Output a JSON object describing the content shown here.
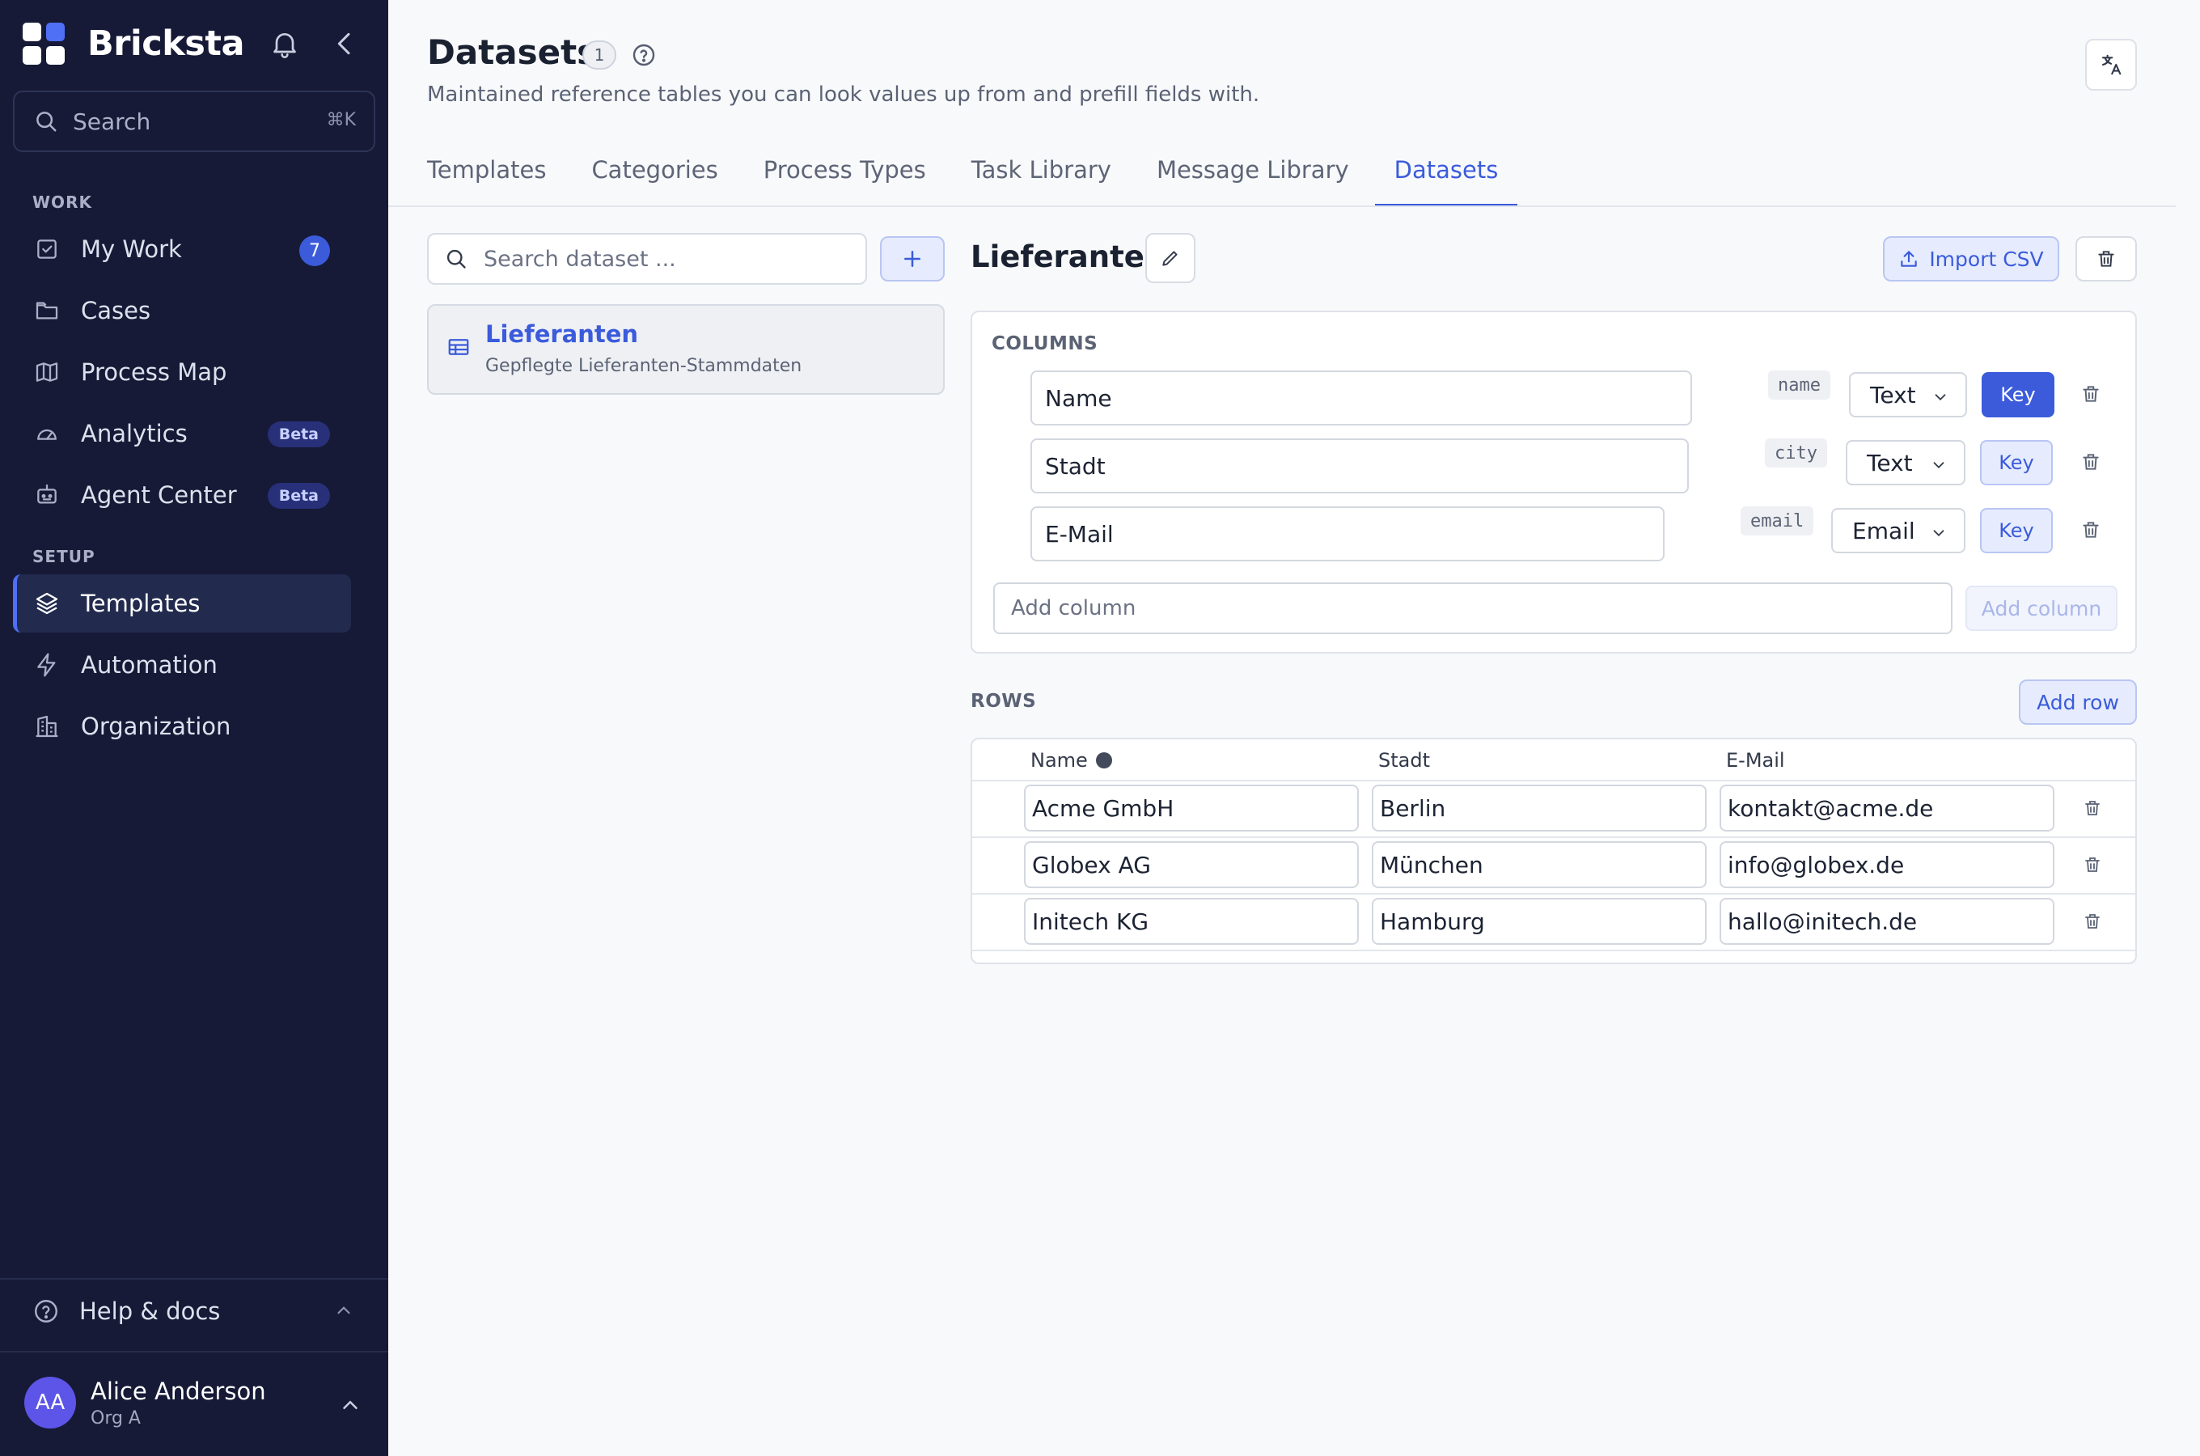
{
  "app": {
    "name": "Bricksta"
  },
  "sidebar": {
    "search": {
      "label": "Search",
      "shortcut": "⌘K"
    },
    "sections": {
      "work": "WORK",
      "setup": "SETUP"
    },
    "work_items": [
      {
        "label": "My Work",
        "icon": "checkbox-icon",
        "count": "7"
      },
      {
        "label": "Cases",
        "icon": "folder-icon"
      },
      {
        "label": "Process Map",
        "icon": "map-icon"
      },
      {
        "label": "Analytics",
        "icon": "gauge-icon",
        "badge": "Beta"
      },
      {
        "label": "Agent Center",
        "icon": "robot-icon",
        "badge": "Beta"
      }
    ],
    "setup_items": [
      {
        "label": "Templates",
        "icon": "layers-icon",
        "active": true
      },
      {
        "label": "Automation",
        "icon": "bolt-icon"
      },
      {
        "label": "Organization",
        "icon": "building-icon"
      }
    ],
    "help": "Help & docs",
    "user": {
      "initials": "AA",
      "name": "Alice Anderson",
      "org": "Org A"
    }
  },
  "header": {
    "title": "Datasets",
    "count": "1",
    "subtitle": "Maintained reference tables you can look values up from and prefill fields with."
  },
  "tabs": [
    {
      "label": "Templates"
    },
    {
      "label": "Categories"
    },
    {
      "label": "Process Types"
    },
    {
      "label": "Task Library"
    },
    {
      "label": "Message Library"
    },
    {
      "label": "Datasets",
      "active": true
    }
  ],
  "datasets": {
    "search_placeholder": "Search dataset ...",
    "items": [
      {
        "name": "Lieferanten",
        "description": "Gepflegte Lieferanten-Stammdaten"
      }
    ]
  },
  "detail": {
    "title": "Lieferanten",
    "import_label": "Import CSV",
    "columns_label": "COLUMNS",
    "columns": [
      {
        "label": "Name",
        "key": "name",
        "type": "Text",
        "is_key": true
      },
      {
        "label": "Stadt",
        "key": "city",
        "type": "Text",
        "is_key": false
      },
      {
        "label": "E-Mail",
        "key": "email",
        "type": "Email",
        "is_key": false
      }
    ],
    "key_label": "Key",
    "add_column_placeholder": "Add column",
    "add_column_button": "Add column",
    "rows_label": "ROWS",
    "add_row_button": "Add row",
    "row_headers": [
      "Name",
      "Stadt",
      "E-Mail"
    ],
    "rows": [
      [
        "Acme GmbH",
        "Berlin",
        "kontakt@acme.de"
      ],
      [
        "Globex AG",
        "München",
        "info@globex.de"
      ],
      [
        "Initech KG",
        "Hamburg",
        "hallo@initech.de"
      ]
    ]
  },
  "colors": {
    "accent": "#3b5bdb",
    "sidebar_bg": "#161a36",
    "page_bg": "#f8f9fb"
  }
}
